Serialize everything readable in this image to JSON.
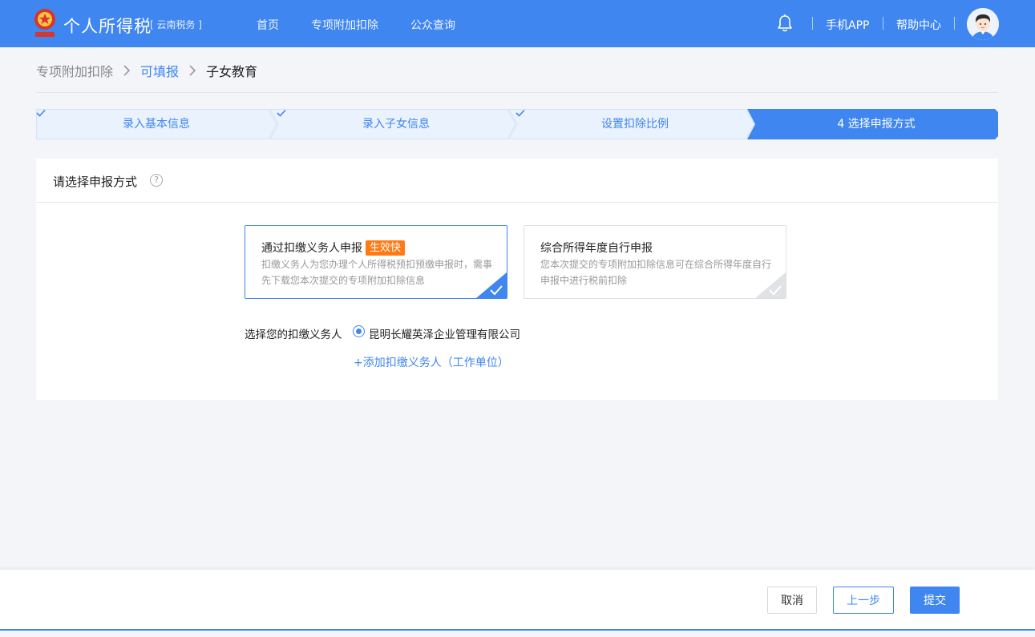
{
  "header": {
    "brand_title": "个人所得税",
    "brand_region": "[ 云南税务 ]",
    "nav": [
      "首页",
      "专项附加扣除",
      "公众查询"
    ],
    "mobile_app": "手机APP",
    "help_center": "帮助中心",
    "icons": {
      "notification": "bell-icon",
      "user": "avatar"
    }
  },
  "breadcrumb": {
    "root": "专项附加扣除",
    "parent": "可填报",
    "current": "子女教育"
  },
  "steps": [
    {
      "label": "录入基本信息",
      "status": "done"
    },
    {
      "label": "录入子女信息",
      "status": "done"
    },
    {
      "label": "设置扣除比例",
      "status": "done"
    },
    {
      "label": "4 选择申报方式",
      "status": "active"
    }
  ],
  "panel": {
    "title": "请选择申报方式",
    "help_icon": "?",
    "options": [
      {
        "title": "通过扣缴义务人申报",
        "badge": "生效快",
        "desc": "扣缴义务人为您办理个人所得税预扣预缴申报时，需事先下载您本次提交的专项附加扣除信息",
        "selected": true
      },
      {
        "title": "综合所得年度自行申报",
        "desc": "您本次提交的专项附加扣除信息可在综合所得年度自行申报中进行税前扣除",
        "selected": false
      }
    ],
    "agent_label": "选择您的扣缴义务人",
    "agent_name": "昆明长耀英泽企业管理有限公司",
    "add_agent": "+添加扣缴义务人（工作单位）"
  },
  "footer": {
    "cancel": "取消",
    "prev": "上一步",
    "submit": "提交"
  },
  "colors": {
    "primary": "#3f86f0",
    "badge": "#ff7a14",
    "step_done_bg": "#eaf2fd"
  }
}
